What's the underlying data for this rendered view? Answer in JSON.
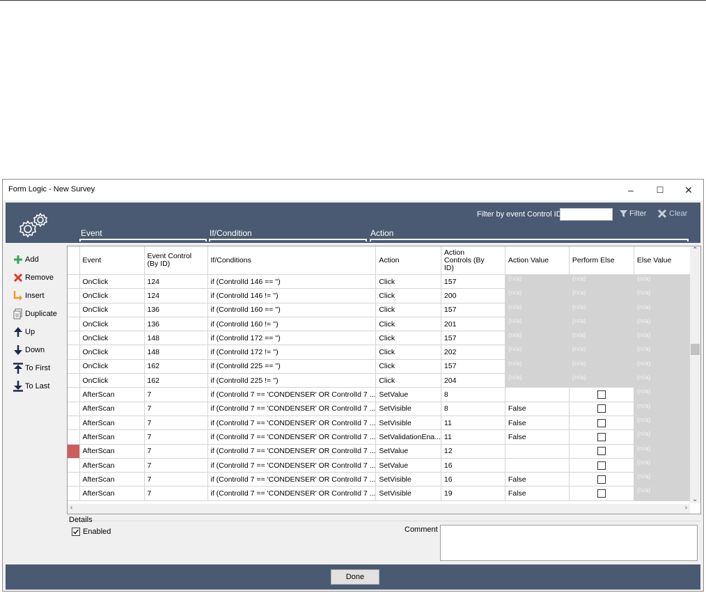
{
  "window": {
    "title": "Form Logic - New Survey",
    "minimize": "–",
    "maximize": "☐",
    "close": "✕"
  },
  "header": {
    "filter_label": "Filter by event Control ID",
    "filter_value": "",
    "filter_button": "Filter",
    "clear_button": "Clear",
    "sections": {
      "event": "Event",
      "condition": "If/Condition",
      "action": "Action"
    }
  },
  "sidebar": {
    "items": [
      {
        "label": "Add",
        "icon": "plus-icon"
      },
      {
        "label": "Remove",
        "icon": "x-icon"
      },
      {
        "label": "Insert",
        "icon": "insert-arrow-icon"
      },
      {
        "label": "Duplicate",
        "icon": "duplicate-icon"
      },
      {
        "label": "Up",
        "icon": "arrow-up-icon"
      },
      {
        "label": "Down",
        "icon": "arrow-down-icon"
      },
      {
        "label": "To First",
        "icon": "to-first-icon"
      },
      {
        "label": "To Last",
        "icon": "to-last-icon"
      }
    ]
  },
  "grid": {
    "columns": [
      "Event",
      "Event Control\n(By ID)",
      "If/Conditions",
      "Action",
      "Action\nControls (By\nID)",
      "Action Value",
      "Perform Else",
      "Else Value"
    ],
    "rows": [
      {
        "event": "OnClick",
        "control": "124",
        "condition": "if (ControlId 146 == '')",
        "action": "Click",
        "action_controls": "157",
        "action_value": "(n/a)",
        "perform_else": "(n/a)",
        "else_value": "(n/a)"
      },
      {
        "event": "OnClick",
        "control": "124",
        "condition": "if (ControlId 146 != '')",
        "action": "Click",
        "action_controls": "200",
        "action_value": "(n/a)",
        "perform_else": "(n/a)",
        "else_value": "(n/a)"
      },
      {
        "event": "OnClick",
        "control": "136",
        "condition": "if (ControlId 160 == '')",
        "action": "Click",
        "action_controls": "157",
        "action_value": "(n/a)",
        "perform_else": "(n/a)",
        "else_value": "(n/a)"
      },
      {
        "event": "OnClick",
        "control": "136",
        "condition": "if (ControlId 160 != '')",
        "action": "Click",
        "action_controls": "201",
        "action_value": "(n/a)",
        "perform_else": "(n/a)",
        "else_value": "(n/a)"
      },
      {
        "event": "OnClick",
        "control": "148",
        "condition": "if (ControlId 172 == '')",
        "action": "Click",
        "action_controls": "157",
        "action_value": "(n/a)",
        "perform_else": "(n/a)",
        "else_value": "(n/a)"
      },
      {
        "event": "OnClick",
        "control": "148",
        "condition": "if (ControlId 172 != '')",
        "action": "Click",
        "action_controls": "202",
        "action_value": "(n/a)",
        "perform_else": "(n/a)",
        "else_value": "(n/a)"
      },
      {
        "event": "OnClick",
        "control": "162",
        "condition": "if (ControlId 225 == '')",
        "action": "Click",
        "action_controls": "157",
        "action_value": "(n/a)",
        "perform_else": "(n/a)",
        "else_value": "(n/a)"
      },
      {
        "event": "OnClick",
        "control": "162",
        "condition": "if (ControlId 225 != '')",
        "action": "Click",
        "action_controls": "204",
        "action_value": "(n/a)",
        "perform_else": "(n/a)",
        "else_value": "(n/a)"
      },
      {
        "event": "AfterScan",
        "control": "7",
        "condition": "if (ControlId 7 == 'CONDENSER' OR ControlId 7 ...",
        "action": "SetValue",
        "action_controls": "8",
        "action_value": "",
        "perform_else": false,
        "else_value": "(n/a)"
      },
      {
        "event": "AfterScan",
        "control": "7",
        "condition": "if (ControlId 7 == 'CONDENSER' OR ControlId 7 ...",
        "action": "SetVisible",
        "action_controls": "8",
        "action_value": "False",
        "perform_else": false,
        "else_value": "(n/a)"
      },
      {
        "event": "AfterScan",
        "control": "7",
        "condition": "if (ControlId 7 == 'CONDENSER' OR ControlId 7 ...",
        "action": "SetVisible",
        "action_controls": "11",
        "action_value": "False",
        "perform_else": false,
        "else_value": "(n/a)"
      },
      {
        "event": "AfterScan",
        "control": "7",
        "condition": "if (ControlId 7 == 'CONDENSER' OR ControlId 7 ...",
        "action": "SetValidationEna...",
        "action_controls": "11",
        "action_value": "False",
        "perform_else": false,
        "else_value": "(n/a)"
      },
      {
        "event": "AfterScan",
        "control": "7",
        "condition": "if (ControlId 7 == 'CONDENSER' OR ControlId 7 ...",
        "action": "SetValue",
        "action_controls": "12",
        "action_value": "",
        "perform_else": false,
        "else_value": "(n/a)",
        "selected": true
      },
      {
        "event": "AfterScan",
        "control": "7",
        "condition": "if (ControlId 7 == 'CONDENSER' OR ControlId 7 ...",
        "action": "SetValue",
        "action_controls": "16",
        "action_value": "",
        "perform_else": false,
        "else_value": "(n/a)"
      },
      {
        "event": "AfterScan",
        "control": "7",
        "condition": "if (ControlId 7 == 'CONDENSER' OR ControlId 7 ...",
        "action": "SetVisible",
        "action_controls": "16",
        "action_value": "False",
        "perform_else": false,
        "else_value": "(n/a)"
      },
      {
        "event": "AfterScan",
        "control": "7",
        "condition": "if (ControlId 7 == 'CONDENSER' OR ControlId 7 ...",
        "action": "SetVisible",
        "action_controls": "19",
        "action_value": "False",
        "perform_else": false,
        "else_value": "(n/a)"
      }
    ]
  },
  "details": {
    "label": "Details",
    "enabled_label": "Enabled",
    "enabled": true,
    "comment_label": "Comment",
    "comment_value": ""
  },
  "footer": {
    "done_label": "Done"
  },
  "colors": {
    "header_bg": "#4a5a73",
    "selected_marker": "#cd5c5c",
    "na_cell": "#d3d3d3"
  }
}
